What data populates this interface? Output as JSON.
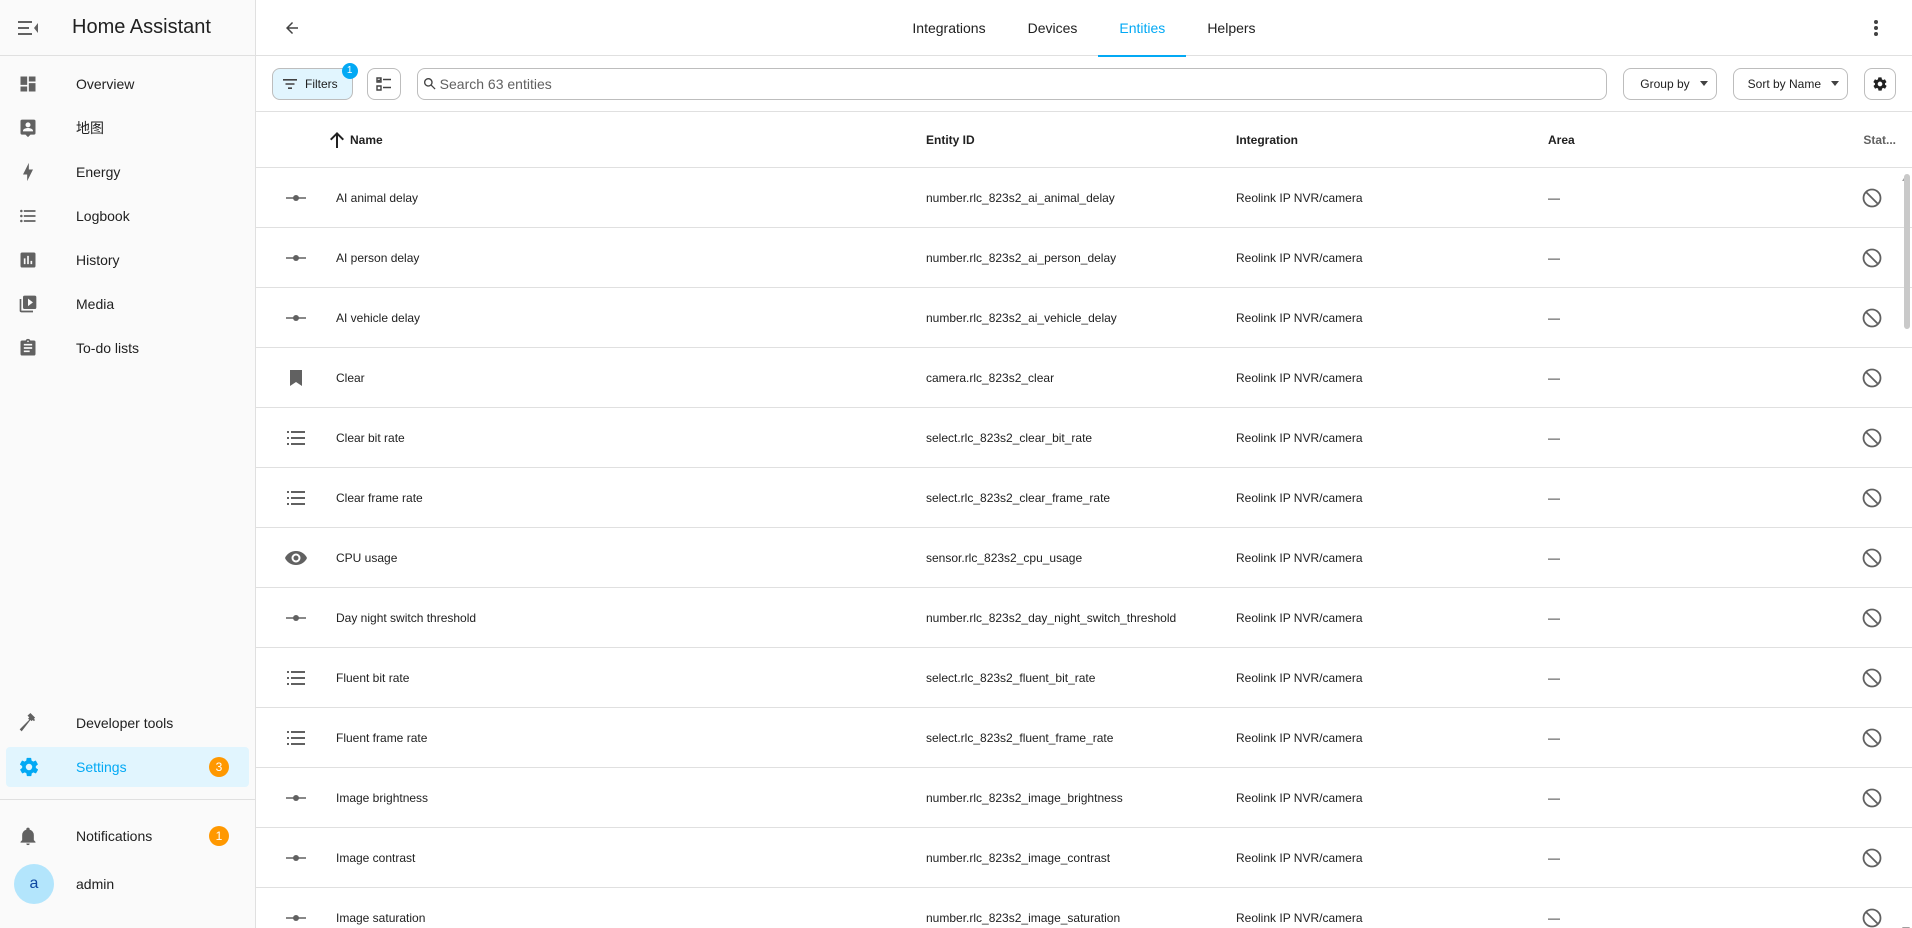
{
  "app": {
    "title": "Home Assistant"
  },
  "sidebar": {
    "items": [
      {
        "label": "Overview",
        "icon": "dashboard-icon"
      },
      {
        "label": "地图",
        "icon": "map-account-icon"
      },
      {
        "label": "Energy",
        "icon": "lightning-bolt-icon"
      },
      {
        "label": "Logbook",
        "icon": "format-list-bulleted-icon"
      },
      {
        "label": "History",
        "icon": "chart-box-icon"
      },
      {
        "label": "Media",
        "icon": "play-box-multiple-icon"
      },
      {
        "label": "To-do lists",
        "icon": "clipboard-list-icon"
      }
    ],
    "developer_tools": "Developer tools",
    "settings": "Settings",
    "settings_badge": "3",
    "notifications": "Notifications",
    "notifications_badge": "1",
    "user_initial": "a",
    "user_name": "admin"
  },
  "tabs": [
    {
      "label": "Integrations",
      "active": false
    },
    {
      "label": "Devices",
      "active": false
    },
    {
      "label": "Entities",
      "active": true
    },
    {
      "label": "Helpers",
      "active": false
    }
  ],
  "toolbar": {
    "filters_label": "Filters",
    "filters_count": "1",
    "search_placeholder": "Search 63 entities",
    "group_by": "Group by",
    "sort_by": "Sort by Name"
  },
  "table": {
    "columns": {
      "name": "Name",
      "entity_id": "Entity ID",
      "integration": "Integration",
      "area": "Area",
      "status": "Stat..."
    },
    "rows": [
      {
        "icon": "slider-icon",
        "name": "AI animal delay",
        "entity_id": "number.rlc_823s2_ai_animal_delay",
        "integration": "Reolink IP NVR/camera",
        "area": "—"
      },
      {
        "icon": "slider-icon",
        "name": "AI person delay",
        "entity_id": "number.rlc_823s2_ai_person_delay",
        "integration": "Reolink IP NVR/camera",
        "area": "—"
      },
      {
        "icon": "slider-icon",
        "name": "AI vehicle delay",
        "entity_id": "number.rlc_823s2_ai_vehicle_delay",
        "integration": "Reolink IP NVR/camera",
        "area": "—"
      },
      {
        "icon": "bookmark-icon",
        "name": "Clear",
        "entity_id": "camera.rlc_823s2_clear",
        "integration": "Reolink IP NVR/camera",
        "area": "—"
      },
      {
        "icon": "list-icon",
        "name": "Clear bit rate",
        "entity_id": "select.rlc_823s2_clear_bit_rate",
        "integration": "Reolink IP NVR/camera",
        "area": "—"
      },
      {
        "icon": "list-icon",
        "name": "Clear frame rate",
        "entity_id": "select.rlc_823s2_clear_frame_rate",
        "integration": "Reolink IP NVR/camera",
        "area": "—"
      },
      {
        "icon": "eye-icon",
        "name": "CPU usage",
        "entity_id": "sensor.rlc_823s2_cpu_usage",
        "integration": "Reolink IP NVR/camera",
        "area": "—"
      },
      {
        "icon": "slider-icon",
        "name": "Day night switch threshold",
        "entity_id": "number.rlc_823s2_day_night_switch_threshold",
        "integration": "Reolink IP NVR/camera",
        "area": "—"
      },
      {
        "icon": "list-icon",
        "name": "Fluent bit rate",
        "entity_id": "select.rlc_823s2_fluent_bit_rate",
        "integration": "Reolink IP NVR/camera",
        "area": "—"
      },
      {
        "icon": "list-icon",
        "name": "Fluent frame rate",
        "entity_id": "select.rlc_823s2_fluent_frame_rate",
        "integration": "Reolink IP NVR/camera",
        "area": "—"
      },
      {
        "icon": "slider-icon",
        "name": "Image brightness",
        "entity_id": "number.rlc_823s2_image_brightness",
        "integration": "Reolink IP NVR/camera",
        "area": "—"
      },
      {
        "icon": "slider-icon",
        "name": "Image contrast",
        "entity_id": "number.rlc_823s2_image_contrast",
        "integration": "Reolink IP NVR/camera",
        "area": "—"
      },
      {
        "icon": "slider-icon",
        "name": "Image saturation",
        "entity_id": "number.rlc_823s2_image_saturation",
        "integration": "Reolink IP NVR/camera",
        "area": "—"
      }
    ]
  },
  "colors": {
    "accent": "#03a9f4",
    "badge": "#ff9800",
    "active_bg": "#e1f5fe"
  }
}
